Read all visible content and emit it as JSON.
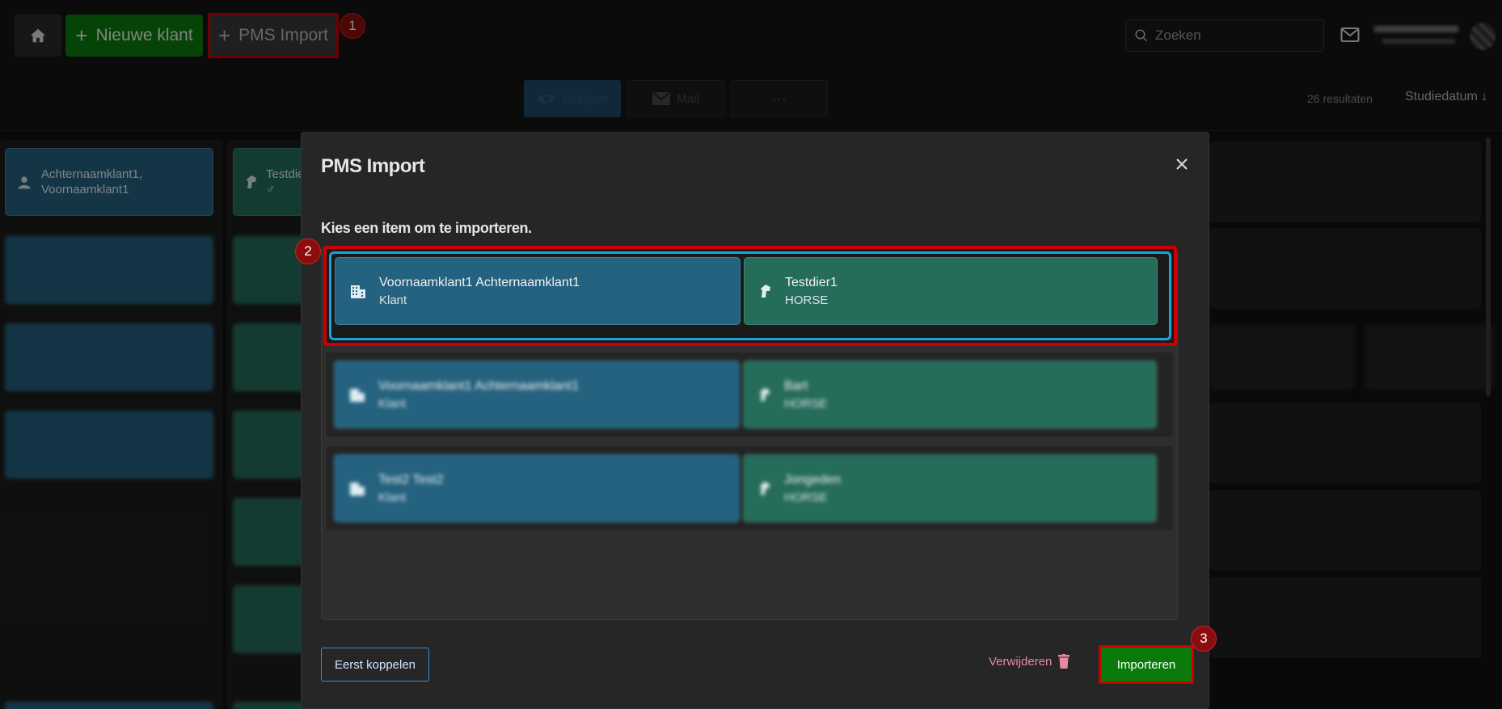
{
  "header": {
    "new_client_label": "Nieuwe klant",
    "pms_import_label": "PMS Import",
    "search_placeholder": "Zoeken",
    "step1": "1",
    "step2": "2",
    "step3": "3"
  },
  "toolbar": {
    "view_label": "Bekijken",
    "mail_label": "Mail",
    "more_label": "···",
    "results": "26 resultaten",
    "sort_label": "Studiedatum ↓"
  },
  "background": {
    "client1_line1": "Achternaamklant1,",
    "client1_line2": "Voornaamklant1",
    "animal1_line1": "Testdie",
    "animal1_line2": "♂"
  },
  "modal": {
    "title": "PMS Import",
    "subtitle": "Kies een item om te importeren.",
    "rows": [
      {
        "client_name": "Voornaamklant1 Achternaamklant1",
        "client_type": "Klant",
        "animal_name": "Testdier1",
        "animal_type": "HORSE"
      },
      {
        "client_name": "Voornaamklant1 Achternaamklant1",
        "client_type": "Klant",
        "animal_name": "Bart",
        "animal_type": "HORSE"
      },
      {
        "client_name": "Test2 Test2",
        "client_type": "Klant",
        "animal_name": "Jongeden",
        "animal_type": "HORSE"
      }
    ],
    "first_link_label": "Eerst koppelen",
    "delete_label": "Verwijderen",
    "import_label": "Importeren"
  },
  "colors": {
    "accent_green": "#0b7a0b",
    "client_blue": "#24627f",
    "animal_green": "#266c5a",
    "highlight_red": "#cc0000",
    "selection_blue": "#1ea0d8"
  }
}
